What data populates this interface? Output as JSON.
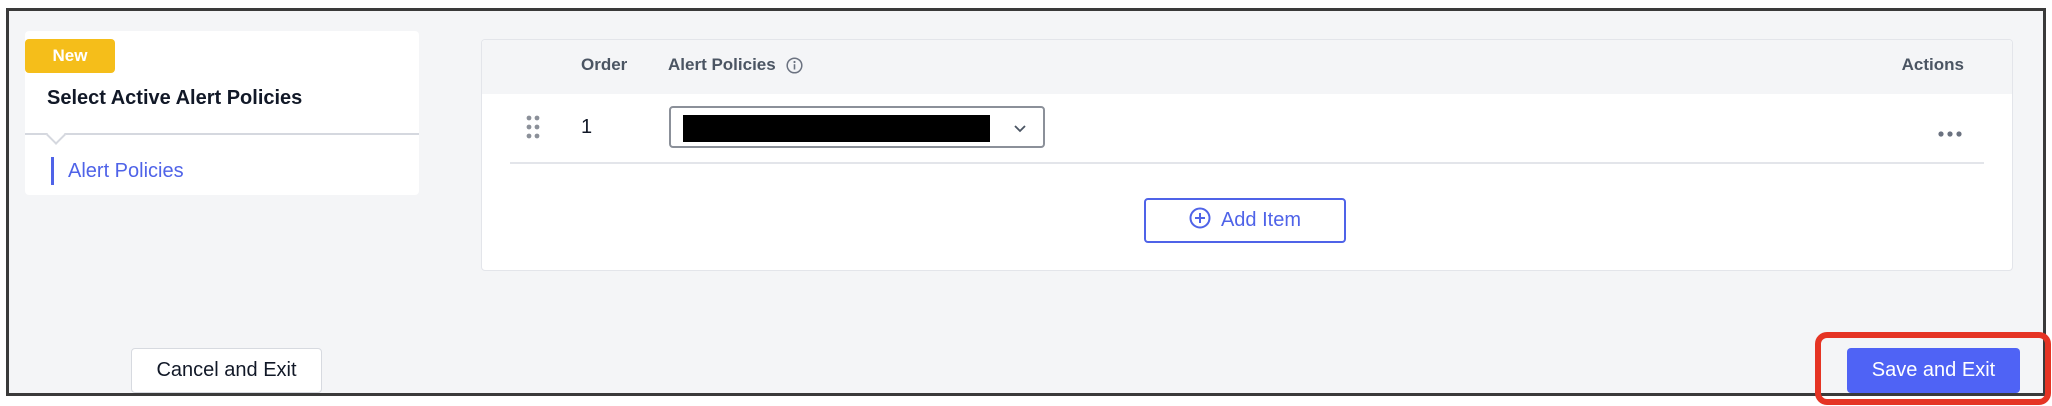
{
  "sidebar": {
    "badge": "New",
    "title": "Select Active Alert Policies",
    "items": [
      {
        "label": "Alert Policies"
      }
    ]
  },
  "table": {
    "headers": {
      "order": "Order",
      "policies": "Alert Policies",
      "actions": "Actions"
    },
    "rows": [
      {
        "order": "1",
        "policy_value": ""
      }
    ],
    "add_item_label": "Add Item"
  },
  "footer": {
    "cancel_label": "Cancel and Exit",
    "save_label": "Save and Exit"
  },
  "colors": {
    "accent": "#4f63e8",
    "badge": "#f5be1a",
    "highlight": "#e53424"
  },
  "icons": [
    "info-icon",
    "drag-handle-icon",
    "chevron-down-icon",
    "more-horizontal-icon",
    "plus-circle-icon"
  ]
}
